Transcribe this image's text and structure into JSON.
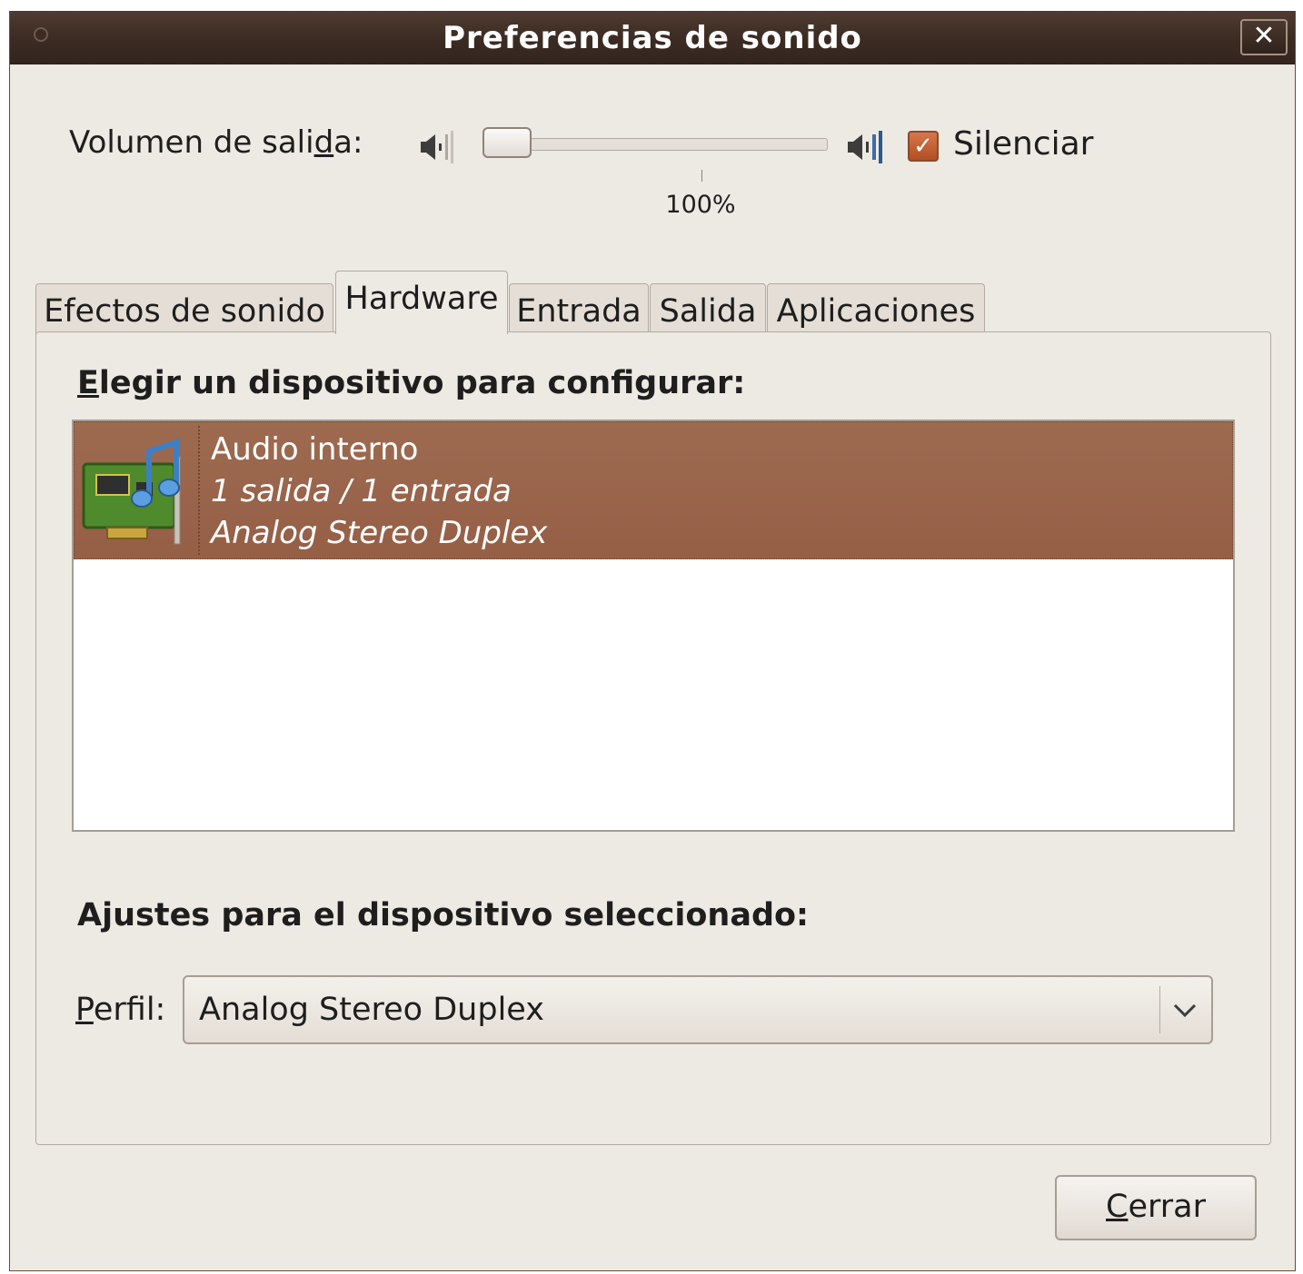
{
  "window": {
    "title": "Preferencias de sonido",
    "close_symbol": "✕"
  },
  "volume": {
    "label_before": "Volumen de sali",
    "label_mnemonic": "d",
    "label_after": "a:",
    "value_mark": "100%",
    "level": 0.0,
    "low_icon": "speaker-low-icon",
    "high_icon": "speaker-high-icon",
    "mute": {
      "label": "Silenciar",
      "checked": true
    }
  },
  "tabs": [
    {
      "label": "Efectos de sonido",
      "active": false
    },
    {
      "label": "Hardware",
      "active": true
    },
    {
      "label": "Entrada",
      "active": false
    },
    {
      "label": "Salida",
      "active": false
    },
    {
      "label": "Aplicaciones",
      "active": false
    }
  ],
  "hardware": {
    "device_section": {
      "title_mnemonic": "E",
      "title_rest": "legir un dispositivo para configurar:"
    },
    "devices": [
      {
        "name": "Audio interno",
        "ports": "1 salida / 1 entrada",
        "profile": "Analog Stereo Duplex",
        "icon": "sound-card-icon",
        "selected": true
      }
    ],
    "settings_section": {
      "title": "Ajustes para el dispositivo seleccionado:"
    },
    "profile": {
      "label_mnemonic": "P",
      "label_rest": "erfil:",
      "value": "Analog Stereo Duplex"
    }
  },
  "footer": {
    "close_mnemonic": "C",
    "close_rest": "errar"
  },
  "colors": {
    "titlebar": "#3b2b23",
    "selection": "#9a654b",
    "window_bg": "#ede9e3",
    "accent_check": "#c9633a"
  }
}
